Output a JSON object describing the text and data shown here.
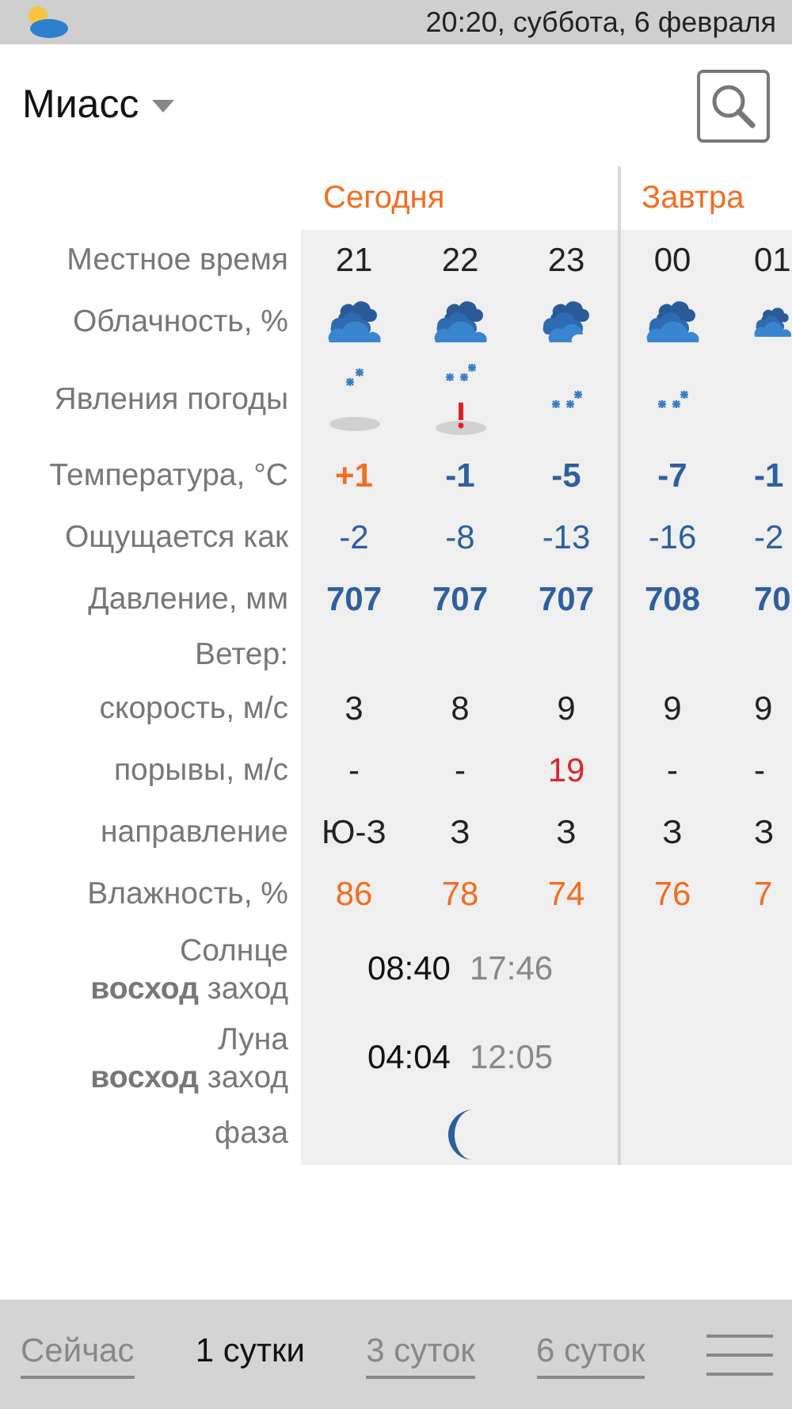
{
  "status_bar": {
    "datetime": "20:20, суббота, 6 февраля"
  },
  "header": {
    "city": "Миасс"
  },
  "labels": {
    "hour": "Местное время",
    "cloud": "Облачность, %",
    "weather": "Явления погоды",
    "temp": "Температура, °C",
    "feels": "Ощущается как",
    "pressure": "Давление, мм",
    "wind": "Ветер:",
    "speed": "скорость, м/с",
    "gusts": "порывы, м/с",
    "direction": "направление",
    "humidity": "Влажность, %",
    "phase": "фаза"
  },
  "days": [
    {
      "label": "Сегодня",
      "hours": [
        {
          "hour": "21",
          "cloud": {
            "kind": "overcast"
          },
          "weather": [
            {
              "kind": "snow_light"
            },
            {
              "kind": "snow_cover"
            }
          ],
          "temp": {
            "text": "+1",
            "color": "#f26d21"
          },
          "feels": "-2",
          "pressure": "707",
          "speed": "3",
          "gusts": {
            "text": "-",
            "color": "#222222"
          },
          "direction": "Ю-З",
          "humidity": "86"
        },
        {
          "hour": "22",
          "cloud": {
            "kind": "overcast"
          },
          "weather": [
            {
              "kind": "snow_moderate"
            },
            {
              "kind": "snow_cover_warning"
            }
          ],
          "temp": {
            "text": "-1",
            "color": "#2f5f9e"
          },
          "feels": "-8",
          "pressure": "707",
          "speed": "8",
          "gusts": {
            "text": "-",
            "color": "#222222"
          },
          "direction": "З",
          "humidity": "78"
        },
        {
          "hour": "23",
          "cloud": {
            "kind": "broken"
          },
          "weather": [
            {
              "kind": "snow_moderate"
            }
          ],
          "temp": {
            "text": "-5",
            "color": "#2f5f9e"
          },
          "feels": "-13",
          "pressure": "707",
          "speed": "9",
          "gusts": {
            "text": "19",
            "color": "#d9262c"
          },
          "direction": "З",
          "humidity": "74"
        }
      ]
    },
    {
      "label": "Завтра",
      "hours": [
        {
          "hour": "00",
          "cloud": {
            "kind": "overcast"
          },
          "weather": [
            {
              "kind": "snow_moderate"
            }
          ],
          "temp": {
            "text": "-7",
            "color": "#2f5f9e"
          },
          "feels": "-16",
          "pressure": "708",
          "speed": "9",
          "gusts": {
            "text": "-",
            "color": "#222222"
          },
          "direction": "З",
          "humidity": "76"
        },
        {
          "hour": "01",
          "cloud": {
            "kind": "overcast"
          },
          "temp": {
            "text": "-1",
            "color": "#2f5f9e"
          },
          "feels": "-2",
          "pressure": "70",
          "speed": "9",
          "gusts": {
            "text": "-",
            "color": "#222222"
          },
          "direction": "З",
          "humidity": "7"
        }
      ]
    }
  ],
  "sun": {
    "title": "Солнце",
    "sub": "**восход** заход",
    "rise": "08:40",
    "set": "17:46"
  },
  "moon": {
    "title": "Луна",
    "sub": "**восход** заход",
    "rise": "04:04",
    "set": "12:05",
    "phase": {
      "kind": "waxing_crescent"
    }
  },
  "tabs": [
    {
      "label": "Сейчас",
      "selected": false
    },
    {
      "label": "1 сутки",
      "selected": true
    },
    {
      "label": "3 суток",
      "selected": false
    },
    {
      "label": "6 суток",
      "selected": false
    }
  ]
}
